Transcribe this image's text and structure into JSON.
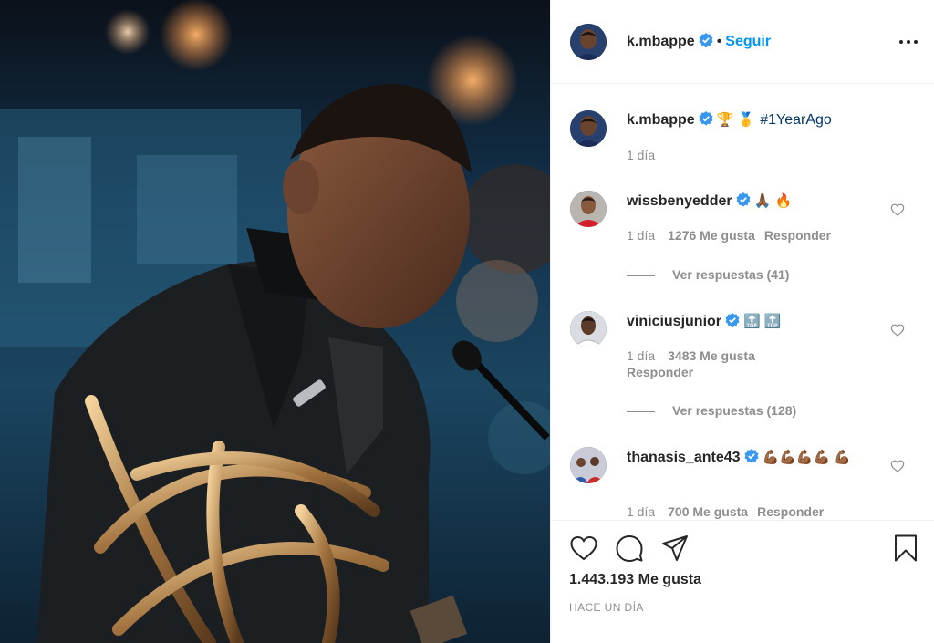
{
  "header": {
    "username": "k.mbappe",
    "separator": "•",
    "follow_label": "Seguir",
    "more_icon": "more-options-icon"
  },
  "caption": {
    "username": "k.mbappe",
    "emoji": "🏆 🥇",
    "hashtag": "#1YearAgo",
    "time": "1 día"
  },
  "comments": [
    {
      "username": "wissbenyedder",
      "text": "🙏🏾 🔥",
      "time": "1 día",
      "likes": "1276 Me gusta",
      "reply_label": "Responder",
      "view_replies": "Ver respuestas (41)"
    },
    {
      "username": "viniciusjunior",
      "text": "🔝 🔝",
      "time": "1 día",
      "likes": "3483 Me gusta",
      "reply_label": "Responder",
      "view_replies": "Ver respuestas (128)"
    },
    {
      "username": "thanasis_ante43",
      "text": "💪🏾💪🏾💪🏾💪🏾 💪🏾",
      "time": "1 día",
      "likes": "700 Me gusta",
      "reply_label": "Responder"
    }
  ],
  "footer": {
    "likes": "1.443.193 Me gusta",
    "time": "HACE UN DÍA"
  },
  "colors": {
    "link_blue": "#0095f6",
    "hashtag": "#00376b",
    "verified": "#3897f0",
    "muted": "#8e8e8e"
  }
}
